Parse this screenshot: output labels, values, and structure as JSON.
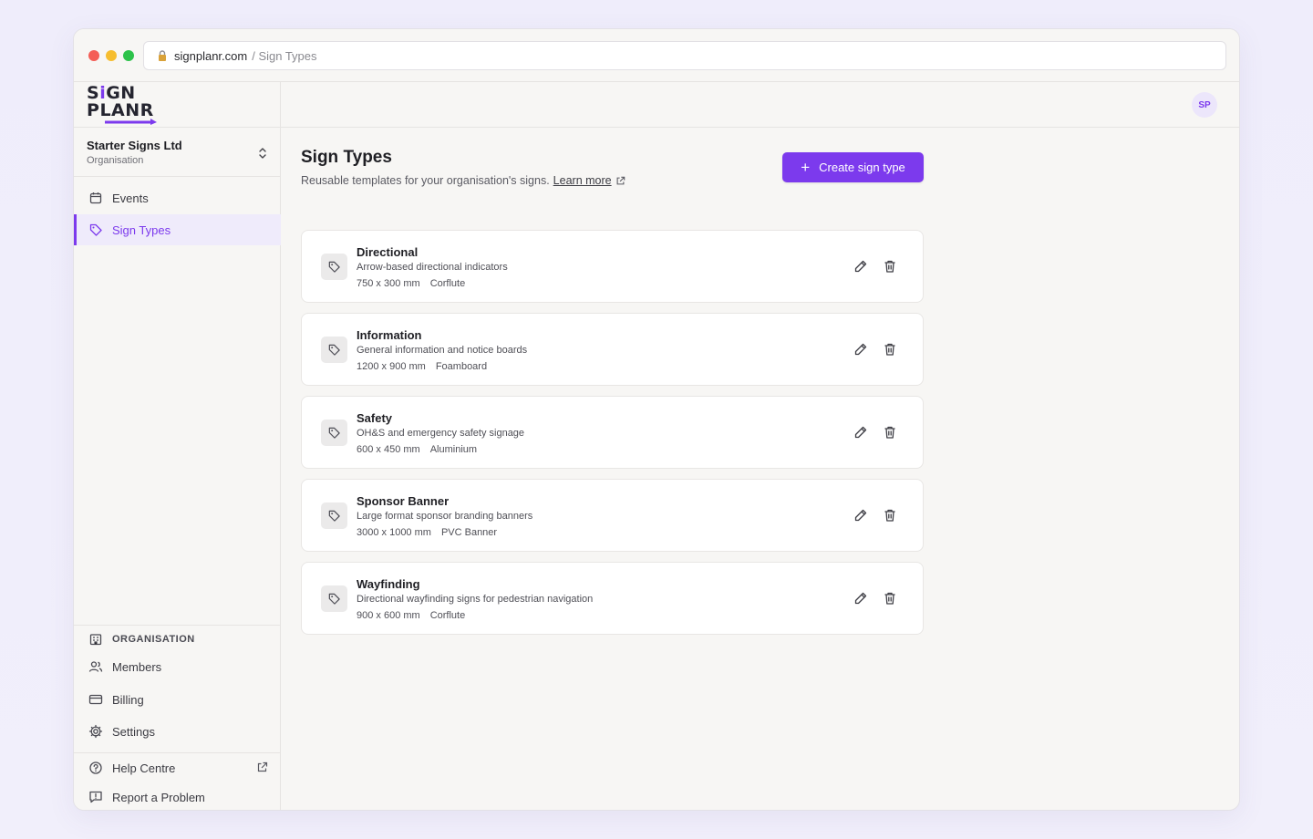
{
  "browser": {
    "host": "signplanr.com",
    "path": "/ Sign Types"
  },
  "brand": {
    "logo_line1_a": "S",
    "logo_line1_i": "i",
    "logo_line1_b": "GN",
    "logo_line2_a": "P",
    "logo_line2_b": "LANR",
    "accent": "#7c3aed"
  },
  "org": {
    "name": "Starter Signs Ltd",
    "subtitle": "Organisation"
  },
  "nav": {
    "events": "Events",
    "sign_types": "Sign Types"
  },
  "org_section": {
    "label": "ORGANISATION",
    "members": "Members",
    "billing": "Billing",
    "settings": "Settings"
  },
  "help": {
    "help_centre": "Help Centre",
    "report": "Report a Problem"
  },
  "user": {
    "initials": "SP"
  },
  "page": {
    "title": "Sign Types",
    "subtitle": "Reusable templates for your organisation's signs.",
    "learn_more": "Learn more",
    "create_button": "Create sign type",
    "plus": "+"
  },
  "sign_types": [
    {
      "name": "Directional",
      "description": "Arrow-based directional indicators",
      "size": "750 x 300 mm",
      "material": "Corflute"
    },
    {
      "name": "Information",
      "description": "General information and notice boards",
      "size": "1200 x 900 mm",
      "material": "Foamboard"
    },
    {
      "name": "Safety",
      "description": "OH&S and emergency safety signage",
      "size": "600 x 450 mm",
      "material": "Aluminium"
    },
    {
      "name": "Sponsor Banner",
      "description": "Large format sponsor branding banners",
      "size": "3000 x 1000 mm",
      "material": "PVC Banner"
    },
    {
      "name": "Wayfinding",
      "description": "Directional wayfinding signs for pedestrian navigation",
      "size": "900 x 600 mm",
      "material": "Corflute"
    }
  ]
}
